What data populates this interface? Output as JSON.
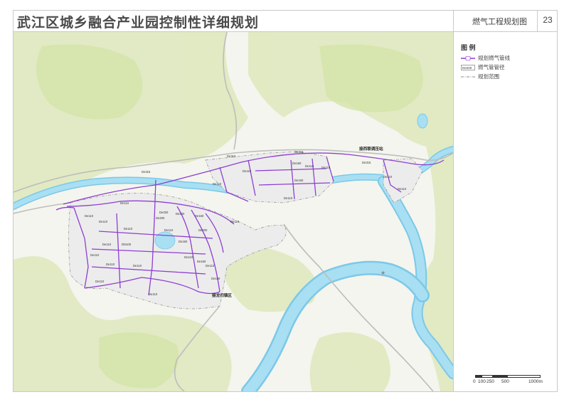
{
  "header": {
    "title": "武江区城乡融合产业园控制性详细规划",
    "subtitle": "燃气工程规划图",
    "page_number": "23"
  },
  "legend": {
    "title": "图 例",
    "items": [
      {
        "symbol": "gas-pipe-line",
        "label": "规划燃气管线",
        "color": "#8e3fd1"
      },
      {
        "symbol": "pipe-diameter-tag",
        "label": "燃气管管径",
        "tag": "De200"
      },
      {
        "symbol": "plan-boundary",
        "label": "规划范围"
      }
    ]
  },
  "map": {
    "station_label": "接西联调压站",
    "town_label": "接龙归镇区",
    "pipe_labels": [
      "De315",
      "De315",
      "De315",
      "De315",
      "De110",
      "De110",
      "De160",
      "De110",
      "De160",
      "De110",
      "De110",
      "De110",
      "De110",
      "De110",
      "De200",
      "De200",
      "De200",
      "De160",
      "De110",
      "DN100",
      "De110",
      "De110",
      "De110",
      "De110",
      "De110",
      "De160",
      "De110",
      "De160",
      "De110",
      "De110",
      "De110",
      "De110",
      "De160",
      "De200",
      "De110",
      "De110"
    ],
    "colors": {
      "water": "#a8dff3",
      "river_edge": "#7cc8e8",
      "green": "#dfe9bf",
      "urban": "#ededed",
      "pipe": "#8e3fd1"
    }
  },
  "compass": {
    "north_label": "N"
  },
  "scale_bar": {
    "labels": [
      "0",
      "100",
      "250",
      "500",
      "1000m"
    ]
  }
}
